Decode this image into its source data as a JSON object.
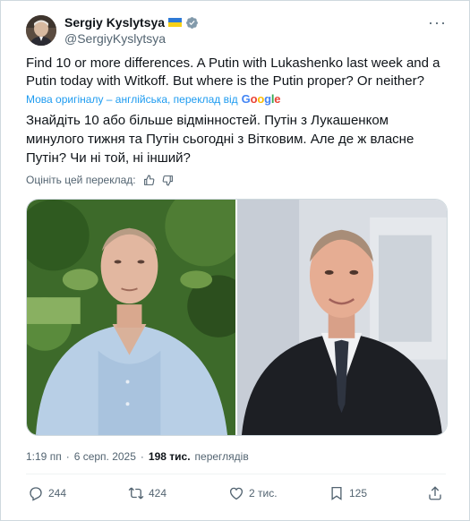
{
  "author": {
    "display_name": "Sergiy Kyslytsya",
    "handle": "@SergiyKyslytsya",
    "verified": true
  },
  "tweet": {
    "text": "Find 10 or more differences. A Putin with Lukashenko last week and a Putin today with Witkoff. But where is the Putin proper? Or neither?",
    "translation_note": "Мова оригіналу – англійська, переклад від",
    "translation_provider": "Google",
    "translated_text": "Знайдіть 10 або більше відмінностей. Путін з Лукашенком минулого тижня та Путін сьогодні з Вітковим. Але де ж власне Путін? Чи ні той, ні інший?",
    "rate_translation": "Оцініть цей переклад:"
  },
  "meta": {
    "time": "1:19 пп",
    "separator": "·",
    "date": "6 серп. 2025",
    "views_count": "198 тис.",
    "views_label": "переглядів"
  },
  "actions": {
    "replies": "244",
    "reposts": "424",
    "likes": "2 тис.",
    "bookmarks": "125"
  },
  "colors": {
    "accent": "#1d9bf0",
    "text": "#0f1419",
    "secondary": "#536471",
    "border": "#cfd9de"
  }
}
